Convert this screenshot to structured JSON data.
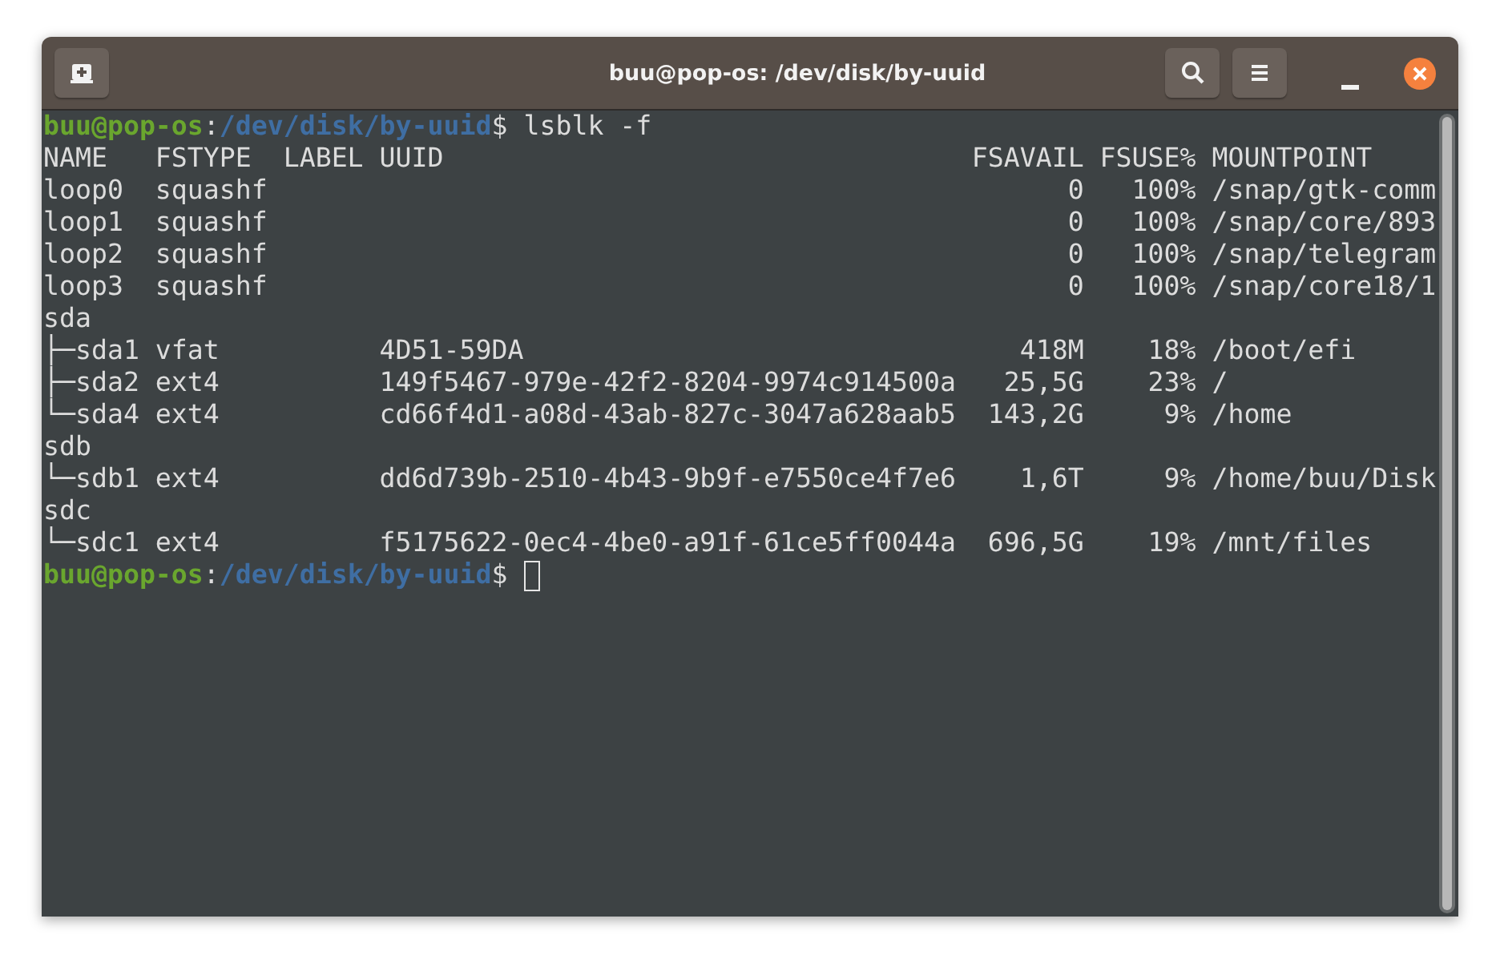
{
  "window": {
    "title": "buu@pop-os: /dev/disk/by-uuid"
  },
  "terminal": {
    "commands": [
      {
        "user": "buu@pop-os",
        "separator": ":",
        "path": "/dev/disk/by-uuid",
        "symbol": "$",
        "command": "lsblk -f"
      }
    ],
    "table": {
      "columns": [
        "NAME",
        "FSTYPE",
        "LABEL",
        "UUID",
        "FSAVAIL",
        "FSUSE%",
        "MOUNTPOINT"
      ],
      "rows": [
        {
          "name": "loop0",
          "fstype": "squashf",
          "fsavail": "0",
          "fsuse": "100%",
          "mountpoint": "/snap/gtk-comm"
        },
        {
          "name": "loop1",
          "fstype": "squashf",
          "fsavail": "0",
          "fsuse": "100%",
          "mountpoint": "/snap/core/893"
        },
        {
          "name": "loop2",
          "fstype": "squashf",
          "fsavail": "0",
          "fsuse": "100%",
          "mountpoint": "/snap/telegram"
        },
        {
          "name": "loop3",
          "fstype": "squashf",
          "fsavail": "0",
          "fsuse": "100%",
          "mountpoint": "/snap/core18/1"
        },
        {
          "name": "sda"
        },
        {
          "name": "├─sda1",
          "fstype": "vfat",
          "uuid": "4D51-59DA",
          "fsavail": "418M",
          "fsuse": "18%",
          "mountpoint": "/boot/efi"
        },
        {
          "name": "├─sda2",
          "fstype": "ext4",
          "uuid": "149f5467-979e-42f2-8204-9974c914500a",
          "fsavail": "25,5G",
          "fsuse": "23%",
          "mountpoint": "/"
        },
        {
          "name": "└─sda4",
          "fstype": "ext4",
          "uuid": "cd66f4d1-a08d-43ab-827c-3047a628aab5",
          "fsavail": "143,2G",
          "fsuse": "9%",
          "mountpoint": "/home"
        },
        {
          "name": "sdb"
        },
        {
          "name": "└─sdb1",
          "fstype": "ext4",
          "uuid": "dd6d739b-2510-4b43-9b9f-e7550ce4f7e6",
          "fsavail": "1,6T",
          "fsuse": "9%",
          "mountpoint": "/home/buu/Disk"
        },
        {
          "name": "sdc"
        },
        {
          "name": "└─sdc1",
          "fstype": "ext4",
          "uuid": "f5175622-0ec4-4be0-a91f-61ce5ff0044a",
          "fsavail": "696,5G",
          "fsuse": "19%",
          "mountpoint": "/mnt/files"
        }
      ]
    },
    "prompt": {
      "user": "buu@pop-os",
      "separator": ":",
      "path": "/dev/disk/by-uuid",
      "symbol": "$",
      "cursor": true
    }
  }
}
